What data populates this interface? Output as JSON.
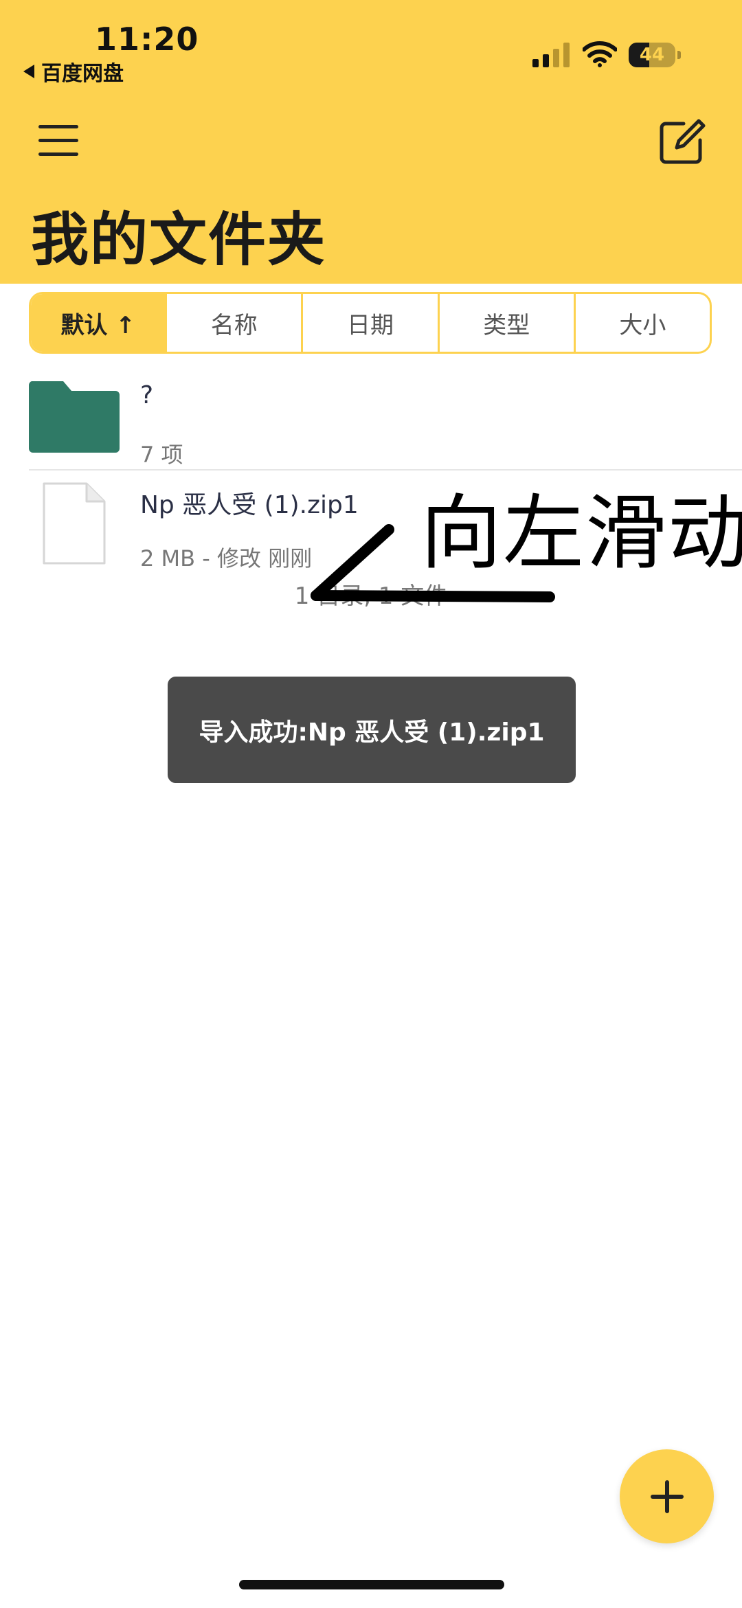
{
  "status_bar": {
    "time": "11:20",
    "back_app": "百度网盘",
    "battery_level": "44",
    "battery_fraction": 0.44
  },
  "header": {
    "title": "我的文件夹"
  },
  "sort_bar": {
    "options": [
      {
        "label": "默认 ↑",
        "active": true
      },
      {
        "label": "名称",
        "active": false
      },
      {
        "label": "日期",
        "active": false
      },
      {
        "label": "类型",
        "active": false
      },
      {
        "label": "大小",
        "active": false
      }
    ]
  },
  "files": [
    {
      "type": "folder",
      "name": "?",
      "meta": "7 项"
    },
    {
      "type": "file",
      "name": "Np 恶人受 (1).zip1",
      "meta": "2 MB - 修改 刚刚"
    }
  ],
  "list_summary": "1 目录, 1 文件",
  "annotation": {
    "text": "向左滑动"
  },
  "toast": {
    "message": "导入成功:Np 恶人受 (1).zip1"
  },
  "colors": {
    "accent": "#FDD24F",
    "folder": "#2F7A66",
    "toast_bg": "#4A4A4A"
  },
  "icons": {
    "menu": "menu-icon",
    "edit": "edit-icon",
    "folder": "folder-icon",
    "file": "file-icon",
    "add": "plus-icon"
  }
}
